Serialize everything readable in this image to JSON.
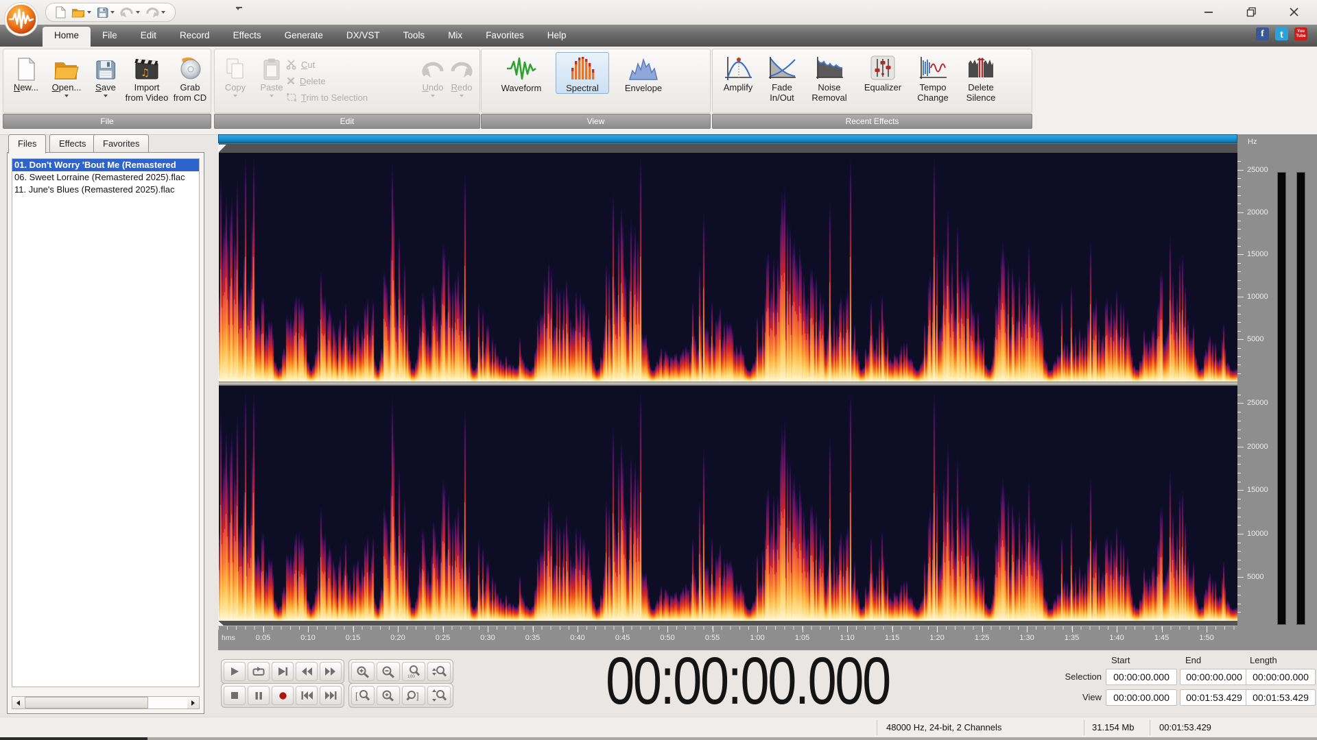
{
  "window": {
    "controls": [
      "minimize",
      "maximize",
      "close"
    ]
  },
  "quick_access": {
    "buttons": [
      "new-file",
      "open-file",
      "save-file",
      "undo",
      "redo"
    ],
    "customize": "customize-quick-access-toolbar"
  },
  "menu": {
    "tabs": [
      "Home",
      "File",
      "Edit",
      "Record",
      "Effects",
      "Generate",
      "DX/VST",
      "Tools",
      "Mix",
      "Favorites",
      "Help"
    ],
    "active_tab": "Home",
    "social": {
      "facebook": "f",
      "twitter": "t",
      "youtube_line1": "You",
      "youtube_line2": "Tube"
    }
  },
  "ribbon": {
    "groups": {
      "file": {
        "label": "File",
        "new": "New...",
        "open": "Open...",
        "save": "Save",
        "import1": "Import",
        "import2": "from Video",
        "grab1": "Grab",
        "grab2": "from CD"
      },
      "edit": {
        "label": "Edit",
        "copy": "Copy",
        "paste": "Paste",
        "cut": "Cut",
        "del": "Delete",
        "trim": "Trim to Selection",
        "undo": "Undo",
        "redo": "Redo"
      },
      "view": {
        "label": "View",
        "waveform": "Waveform",
        "spectral": "Spectral",
        "envelope": "Envelope",
        "active": "Spectral"
      },
      "recent": {
        "label": "Recent Effects",
        "amplify": "Amplify",
        "fade1": "Fade",
        "fade2": "In/Out",
        "noise1": "Noise",
        "noise2": "Removal",
        "equalizer": "Equalizer",
        "tempo1": "Tempo",
        "tempo2": "Change",
        "silence1": "Delete",
        "silence2": "Silence"
      }
    }
  },
  "file_panel": {
    "tabs": [
      "Files",
      "Effects",
      "Favorites"
    ],
    "active_tab": "Files",
    "files": [
      "01. Don't Worry 'Bout Me (Remastered",
      "06. Sweet Lorraine (Remastered 2025).flac",
      "11. June's Blues (Remastered 2025).flac"
    ],
    "selected_index": 0
  },
  "editor": {
    "hz_label": "Hz",
    "freq_labels": [
      "25000",
      "20000",
      "15000",
      "10000",
      "5000"
    ],
    "time_origin_label": "hms",
    "time_labels": [
      "0:05",
      "0:10",
      "0:15",
      "0:20",
      "0:25",
      "0:30",
      "0:35",
      "0:40",
      "0:45",
      "0:50",
      "0:55",
      "1:00",
      "1:05",
      "1:10",
      "1:15",
      "1:20",
      "1:25",
      "1:30",
      "1:35",
      "1:40",
      "1:45",
      "1:50"
    ],
    "view_seconds": 113.429,
    "channels": 2
  },
  "transport": {
    "playback_row1": [
      "play",
      "loop-playback",
      "play-to-next",
      "rewind",
      "fast-forward"
    ],
    "playback_row2": [
      "stop",
      "pause",
      "record",
      "go-to-start",
      "go-to-end"
    ],
    "zoom_row1": [
      "zoom-in",
      "zoom-out",
      "zoom-100-percent",
      "zoom-vertical"
    ],
    "zoom_row2": [
      "zoom-selection-start",
      "zoom-in-selection",
      "zoom-selection-end",
      "zoom-vertical-out"
    ]
  },
  "time_display": {
    "value": "00:00:00.000"
  },
  "selection_panel": {
    "headers": [
      "Start",
      "End",
      "Length"
    ],
    "rows": [
      {
        "label": "Selection",
        "values": [
          "00:00:00.000",
          "00:00:00.000",
          "00:00:00.000"
        ]
      },
      {
        "label": "View",
        "values": [
          "00:00:00.000",
          "00:01:53.429",
          "00:01:53.429"
        ]
      }
    ]
  },
  "status_bar": {
    "audio_format": "48000 Hz, 24-bit, 2 Channels",
    "file_size": "31.154 Mb",
    "duration": "00:01:53.429"
  },
  "colors": {
    "selection_blue": "#2c63cc",
    "scrollbar_blue": "#1d96d2",
    "spectrogram_bg": "#0d0d26",
    "record_red": "#ae1515"
  }
}
